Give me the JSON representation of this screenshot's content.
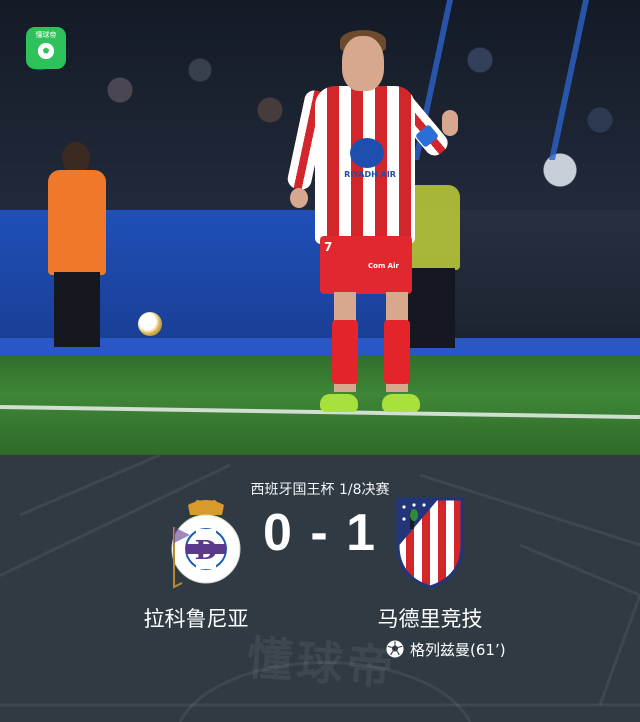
{
  "app_logo": {
    "text": "懂球帝"
  },
  "photo": {
    "player_number": "7",
    "sponsor_text": "RIYADH AIR",
    "shorts_sponsor": "Com Air"
  },
  "match": {
    "competition": "西班牙国王杯  1/8决赛",
    "home_team": "拉科鲁尼亚",
    "away_team": "马德里竞技",
    "score": "0 - 1",
    "scorer": "格列兹曼(61’)",
    "home_crest_text": "REAL CLUB DEPORTIVO · LA CORUÑA"
  },
  "watermark": "懂球帝",
  "colors": {
    "card_bg": "#2f3a43",
    "app_green": "#2ec25a",
    "atletico_red": "#d2262b",
    "atletico_blue": "#22357a",
    "deportivo_blue": "#1a5fb4"
  }
}
